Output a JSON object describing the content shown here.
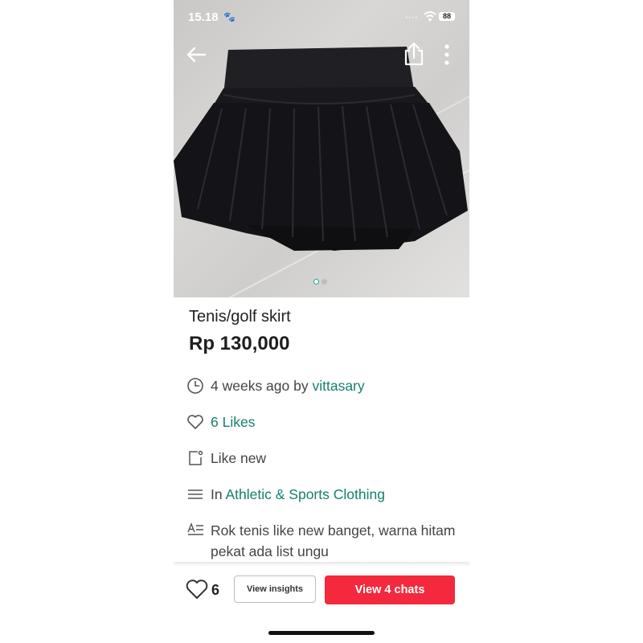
{
  "status_bar": {
    "time": "15.18",
    "signal_dots": "••••",
    "battery": "88"
  },
  "photo": {
    "pager_total": 2,
    "pager_active": 1
  },
  "product": {
    "title": "Tenis/golf skirt",
    "price": "Rp 130,000",
    "posted": "4 weeks ago by ",
    "seller": "vittasary",
    "likes": "6 Likes",
    "condition": "Like new",
    "category_prefix": "In ",
    "category": "Athletic & Sports Clothing",
    "description": "Rok tenis like new banget, warna hitam pekat ada list ungu"
  },
  "bottom_bar": {
    "like_count": "6",
    "insights_label": "View insights",
    "chats_label": "View 4 chats"
  },
  "icons": {
    "back": "arrow-left-icon",
    "share": "share-icon",
    "more": "more-vertical-icon",
    "clock": "clock-icon",
    "heart": "heart-icon",
    "condition": "tag-icon",
    "category": "list-icon",
    "description": "text-icon"
  },
  "colors": {
    "accent_green": "#14806f",
    "cta_red": "#f4293d"
  }
}
